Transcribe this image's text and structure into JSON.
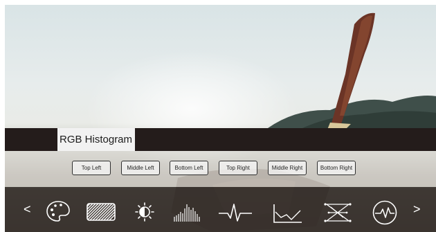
{
  "panel": {
    "title": "RGB Histogram"
  },
  "position_buttons": [
    {
      "label": "Top Left"
    },
    {
      "label": "Middle Left"
    },
    {
      "label": "Bottom Left"
    },
    {
      "label": "Top Right"
    },
    {
      "label": "Middle Right"
    },
    {
      "label": "Bottom Right"
    }
  ],
  "toolbar": {
    "prev_label": "<",
    "next_label": ">",
    "tools": [
      {
        "icon": "palette-icon"
      },
      {
        "icon": "zebra-stripes-icon"
      },
      {
        "icon": "brightness-icon"
      },
      {
        "icon": "histogram-icon"
      },
      {
        "icon": "waveform-icon"
      },
      {
        "icon": "line-graph-icon"
      },
      {
        "icon": "vectorscope-icon"
      },
      {
        "icon": "pulse-monitor-icon"
      }
    ]
  },
  "colors": {
    "title_bar": "#241c1b",
    "toolbar": "#282220",
    "icon_stroke": "#ffffff"
  }
}
